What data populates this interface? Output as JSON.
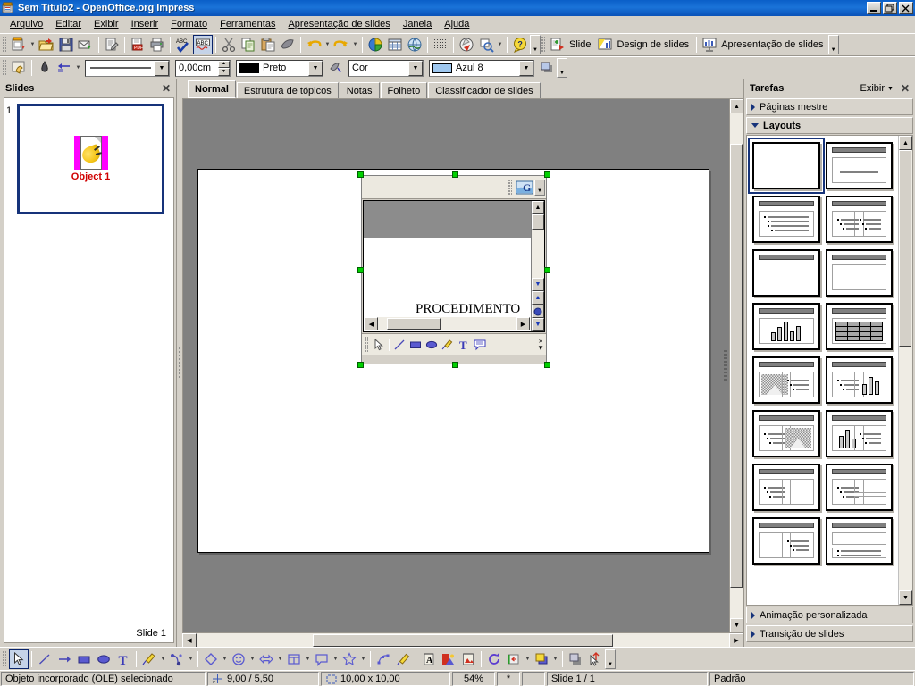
{
  "window": {
    "title": "Sem Título2 - OpenOffice.org Impress",
    "app_icon": "impress-app-icon",
    "minimize": "_",
    "maximize": "❐",
    "close": "✕"
  },
  "menubar": {
    "items": [
      {
        "label": "Arquivo",
        "name": "menu-arquivo"
      },
      {
        "label": "Editar",
        "name": "menu-editar"
      },
      {
        "label": "Exibir",
        "name": "menu-exibir"
      },
      {
        "label": "Inserir",
        "name": "menu-inserir"
      },
      {
        "label": "Formato",
        "name": "menu-formato"
      },
      {
        "label": "Ferramentas",
        "name": "menu-ferramentas"
      },
      {
        "label": "Apresentação de slides",
        "name": "menu-apresentacao-de-slides"
      },
      {
        "label": "Janela",
        "name": "menu-janela"
      },
      {
        "label": "Ajuda",
        "name": "menu-ajuda"
      }
    ]
  },
  "standard_toolbar": {
    "buttons": [
      {
        "name": "new-document-icon",
        "tip": "Novo"
      },
      {
        "name": "open-document-icon",
        "tip": "Abrir"
      },
      {
        "name": "save-document-icon",
        "tip": "Salvar"
      },
      {
        "name": "send-email-icon",
        "tip": "Documento como e-mail"
      },
      {
        "name": "edit-file-icon",
        "tip": "Editar arquivo"
      },
      {
        "name": "export-pdf-icon",
        "tip": "Exportar diretamente como PDF"
      },
      {
        "name": "print-icon",
        "tip": "Imprimir arquivo diretamente"
      },
      {
        "name": "spellcheck-icon",
        "tip": "Ortografia e gramática"
      },
      {
        "name": "autospellcheck-icon",
        "tip": "Verificação ortográfica automática"
      },
      {
        "name": "cut-icon",
        "tip": "Cortar"
      },
      {
        "name": "copy-icon",
        "tip": "Copiar"
      },
      {
        "name": "paste-icon",
        "tip": "Colar"
      },
      {
        "name": "clone-formatting-icon",
        "tip": "Pincel de formatação"
      },
      {
        "name": "undo-icon",
        "tip": "Desfazer"
      },
      {
        "name": "redo-icon",
        "tip": "Refazer"
      },
      {
        "name": "insert-chart-icon",
        "tip": "Inserir gráfico"
      },
      {
        "name": "insert-table-icon",
        "tip": "Tabela"
      },
      {
        "name": "insert-image-icon",
        "tip": "A partir de arquivo"
      },
      {
        "name": "grid-icon",
        "tip": "Exibir grade"
      },
      {
        "name": "navigator-icon",
        "tip": "Navegador"
      },
      {
        "name": "zoom-icon",
        "tip": "Zoom"
      },
      {
        "name": "help-icon",
        "tip": "Ajuda do OpenOffice.org"
      }
    ],
    "slide_label": "Slide",
    "slide_design_label": "Design de slides",
    "slideshow_label": "Apresentação de slides"
  },
  "line_fill_toolbar": {
    "point_edit_icon": "points-edit-icon",
    "glue_points_icon": "glue-points-icon",
    "arrow_style_icon": "arrow-style-icon",
    "line_style_value": "——————",
    "line_width_value": "0,00cm",
    "line_color_value": "Preto",
    "line_color_hex": "#000000",
    "area_style_value": "Cor",
    "area_fill_value": "Azul 8",
    "area_fill_hex": "#9fc8f0",
    "shadow_icon": "shadow-icon"
  },
  "slides_panel": {
    "title": "Slides",
    "close_icon": "close-icon",
    "slides": [
      {
        "number": "1",
        "object_label": "Object 1"
      }
    ],
    "footer": "Slide 1"
  },
  "view_tabs": [
    {
      "label": "Normal",
      "active": true,
      "name": "tab-normal"
    },
    {
      "label": "Estrutura de tópicos",
      "active": false,
      "name": "tab-estrutura-de-topicos"
    },
    {
      "label": "Notas",
      "active": false,
      "name": "tab-notas"
    },
    {
      "label": "Folheto",
      "active": false,
      "name": "tab-folheto"
    },
    {
      "label": "Classificador de slides",
      "active": false,
      "name": "tab-classificador-de-slides"
    }
  ],
  "ole_object": {
    "document_text": "PROCEDIMENTO",
    "toolbar_icon": "ole-writer-icon",
    "drawing_tools": [
      {
        "name": "select-arrow-icon"
      },
      {
        "name": "line-icon"
      },
      {
        "name": "rectangle-icon"
      },
      {
        "name": "ellipse-icon"
      },
      {
        "name": "freeform-line-icon"
      },
      {
        "name": "text-icon"
      },
      {
        "name": "callout-icon"
      }
    ],
    "overflow_label": "»"
  },
  "tasks_panel": {
    "title": "Tarefas",
    "view_label": "Exibir",
    "close_icon": "close-icon",
    "sections": [
      {
        "label": "Páginas mestre",
        "open": false,
        "name": "task-section-paginas-mestre"
      },
      {
        "label": "Layouts",
        "open": true,
        "name": "task-section-layouts"
      },
      {
        "label": "Animação personalizada",
        "open": false,
        "name": "task-section-animacao-personalizada"
      },
      {
        "label": "Transição de slides",
        "open": false,
        "name": "task-section-transicao-de-slides"
      }
    ],
    "layouts": [
      {
        "kind": "blank",
        "selected": true,
        "name": "layout-blank"
      },
      {
        "kind": "title-content",
        "selected": false,
        "name": "layout-title-content"
      },
      {
        "kind": "title-bullets",
        "selected": false,
        "name": "layout-title-bullets"
      },
      {
        "kind": "title-two-bullets",
        "selected": false,
        "name": "layout-title-two-bullets"
      },
      {
        "kind": "title-only",
        "selected": false,
        "name": "layout-title-only"
      },
      {
        "kind": "title-empty-box",
        "selected": false,
        "name": "layout-title-empty-box"
      },
      {
        "kind": "title-chart",
        "selected": false,
        "name": "layout-title-chart"
      },
      {
        "kind": "title-table",
        "selected": false,
        "name": "layout-title-table"
      },
      {
        "kind": "title-image-bullets",
        "selected": false,
        "name": "layout-title-image-bullets"
      },
      {
        "kind": "title-bullets-chart",
        "selected": false,
        "name": "layout-title-bullets-chart"
      },
      {
        "kind": "title-bullets-image",
        "selected": false,
        "name": "layout-title-bullets-image"
      },
      {
        "kind": "title-chart-bullets",
        "selected": false,
        "name": "layout-title-chart-bullets"
      },
      {
        "kind": "title-bullets-box",
        "selected": false,
        "name": "layout-title-bullets-box"
      },
      {
        "kind": "title-bullets-two-box",
        "selected": false,
        "name": "layout-title-bullets-two-box"
      },
      {
        "kind": "title-box-bullets",
        "selected": false,
        "name": "layout-title-box-bullets"
      },
      {
        "kind": "title-box-bullet-lines",
        "selected": false,
        "name": "layout-title-box-bullet-lines"
      }
    ]
  },
  "draw_toolbar": {
    "buttons": [
      {
        "name": "select-arrow-icon",
        "active": true
      },
      {
        "name": "line-icon",
        "active": false
      },
      {
        "name": "arrow-line-icon",
        "active": false
      },
      {
        "name": "rectangle-icon",
        "active": false
      },
      {
        "name": "ellipse-icon",
        "active": false
      },
      {
        "name": "text-box-icon",
        "active": false
      },
      {
        "name": "curve-icon",
        "active": false,
        "dropdown": true
      },
      {
        "name": "connector-icon",
        "active": false,
        "dropdown": true
      },
      {
        "name": "basic-shapes-icon",
        "active": false,
        "dropdown": true
      },
      {
        "name": "symbol-shapes-icon",
        "active": false,
        "dropdown": true
      },
      {
        "name": "block-arrows-icon",
        "active": false,
        "dropdown": true
      },
      {
        "name": "flowchart-shapes-icon",
        "active": false,
        "dropdown": true
      },
      {
        "name": "callout-shapes-icon",
        "active": false,
        "dropdown": true
      },
      {
        "name": "stars-shapes-icon",
        "active": false,
        "dropdown": true
      },
      {
        "name": "points-icon",
        "active": false
      },
      {
        "name": "glue-points-icon",
        "active": false
      },
      {
        "name": "fontwork-gallery-icon",
        "active": false
      },
      {
        "name": "from-file-image-icon",
        "active": false
      },
      {
        "name": "gallery-icon",
        "active": false
      },
      {
        "name": "rotate-icon",
        "active": false
      },
      {
        "name": "alignment-icon",
        "active": false,
        "dropdown": true
      },
      {
        "name": "arrange-icon",
        "active": false,
        "dropdown": true
      },
      {
        "name": "shadow-toggle-icon",
        "active": false
      },
      {
        "name": "interaction-icon",
        "active": false
      }
    ]
  },
  "statusbar": {
    "message": "Objeto incorporado (OLE) selecionado",
    "position": "9,00 / 5,50",
    "size": "10,00 x 10,00",
    "zoom": "54%",
    "modified": "*",
    "signature": "",
    "slide_info": "Slide 1 / 1",
    "master": "Padrão"
  }
}
